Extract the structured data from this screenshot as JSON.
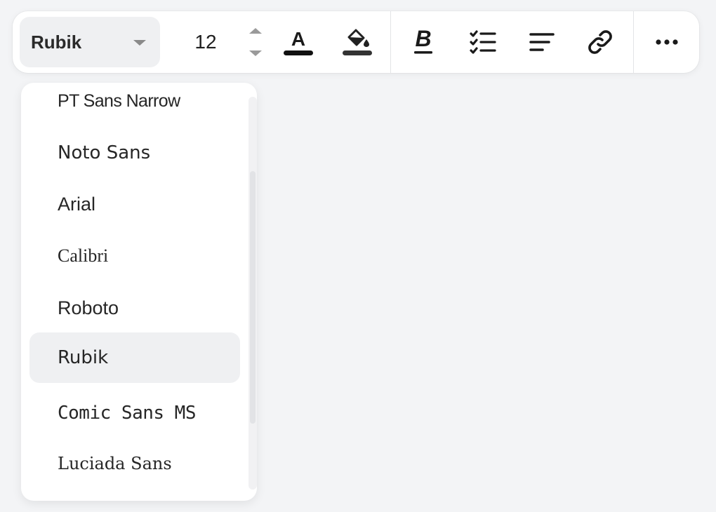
{
  "toolbar": {
    "font_family": "Rubik",
    "font_size": "12",
    "buttons": [
      {
        "name": "text-color-button",
        "icon": "text-color-icon"
      },
      {
        "name": "highlight-button",
        "icon": "paint-bucket-icon"
      },
      {
        "name": "bold-button",
        "icon": "bold-icon"
      },
      {
        "name": "checklist-button",
        "icon": "checklist-icon"
      },
      {
        "name": "align-button",
        "icon": "align-left-icon"
      },
      {
        "name": "link-button",
        "icon": "link-icon"
      },
      {
        "name": "more-button",
        "icon": "more-horizontal-icon"
      }
    ],
    "text_color": "#1a1a1a",
    "highlight_color": "#333333"
  },
  "font_dropdown": {
    "selected": "Rubik",
    "items": [
      "PT Sans Narrow",
      "Noto Sans",
      "Arial",
      "Calibri",
      "Roboto",
      "Rubik",
      "Comic Sans MS",
      "Luciada Sans"
    ]
  },
  "colors": {
    "background": "#f3f4f6",
    "surface": "#ffffff",
    "selected_bg": "#eff0f2"
  }
}
